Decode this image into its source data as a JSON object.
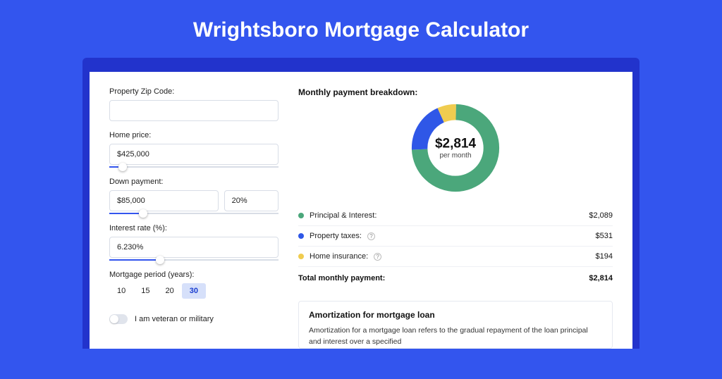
{
  "title": "Wrightsboro Mortgage Calculator",
  "form": {
    "zip_label": "Property Zip Code:",
    "zip_value": "",
    "home_price_label": "Home price:",
    "home_price_value": "$425,000",
    "home_price_slider_pct": 8,
    "down_label": "Down payment:",
    "down_value": "$85,000",
    "down_pct_value": "20%",
    "down_slider_pct": 20,
    "rate_label": "Interest rate (%):",
    "rate_value": "6.230%",
    "rate_slider_pct": 30,
    "period_label": "Mortgage period (years):",
    "periods": [
      "10",
      "15",
      "20",
      "30"
    ],
    "period_active": "30",
    "veteran_label": "I am veteran or military"
  },
  "breakdown": {
    "heading": "Monthly payment breakdown:",
    "total_display": "$2,814",
    "per_month": "per month",
    "items": [
      {
        "label": "Principal & Interest:",
        "value": "$2,089",
        "color": "#4ba77b",
        "help": false
      },
      {
        "label": "Property taxes:",
        "value": "$531",
        "color": "#2f57e7",
        "help": true
      },
      {
        "label": "Home insurance:",
        "value": "$194",
        "color": "#f0cc4f",
        "help": true
      }
    ],
    "total_label": "Total monthly payment:",
    "total_value": "$2,814"
  },
  "amort": {
    "title": "Amortization for mortgage loan",
    "text": "Amortization for a mortgage loan refers to the gradual repayment of the loan principal and interest over a specified"
  },
  "chart_data": {
    "type": "pie",
    "title": "Monthly payment breakdown",
    "series": [
      {
        "name": "Principal & Interest",
        "value": 2089,
        "color": "#4ba77b"
      },
      {
        "name": "Property taxes",
        "value": 531,
        "color": "#2f57e7"
      },
      {
        "name": "Home insurance",
        "value": 194,
        "color": "#f0cc4f"
      }
    ],
    "total": 2814,
    "center_label": "$2,814 per month"
  }
}
